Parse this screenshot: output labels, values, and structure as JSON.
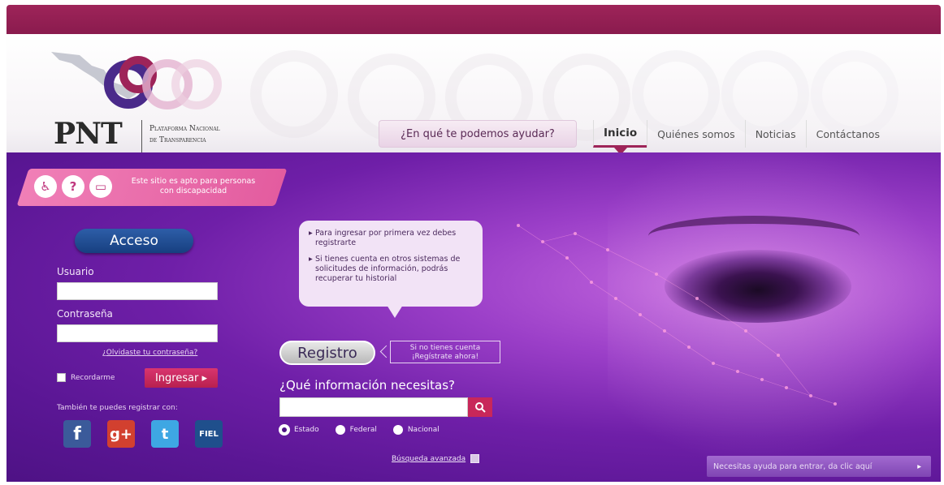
{
  "header": {
    "logo_abbrev": "PNT",
    "logo_line1": "Plataforma Nacional",
    "logo_line2": "de Transparencia",
    "help_prompt": "¿En qué te podemos ayudar?",
    "nav": [
      {
        "label": "Inicio",
        "active": true
      },
      {
        "label": "Quiénes somos",
        "active": false
      },
      {
        "label": "Noticias",
        "active": false
      },
      {
        "label": "Contáctanos",
        "active": false
      }
    ]
  },
  "accessibility": {
    "text": "Este sitio es apto para personas con discapacidad",
    "icons": [
      "wheelchair-icon",
      "hearing-icon",
      "speech-icon"
    ]
  },
  "login": {
    "title": "Acceso",
    "user_label": "Usuario",
    "user_value": "",
    "password_label": "Contraseña",
    "password_value": "",
    "forgot": "¿Olvidaste tu contraseña?",
    "remember": "Recordarme",
    "submit": "Ingresar ▸",
    "social_text": "También te puedes registrar con:",
    "social": [
      "f",
      "g+",
      "t",
      "FIEL"
    ]
  },
  "info_bubble": {
    "item1": "Para ingresar por primera vez debes registrarte",
    "item2": "Si tienes cuenta en otros sistemas de solicitudes de información, podrás recuperar tu historial"
  },
  "register": {
    "button": "Registro",
    "note": "Si no tienes cuenta ¡Regístrate ahora!"
  },
  "search": {
    "question": "¿Qué información necesitas?",
    "value": "",
    "options": [
      {
        "label": "Estado",
        "selected": true
      },
      {
        "label": "Federal",
        "selected": false
      },
      {
        "label": "Nacional",
        "selected": false
      }
    ],
    "advanced": "Búsqueda avanzada"
  },
  "help_bar": {
    "text": "Necesitas ayuda para entrar, da clic aquí",
    "arrow": "▸"
  },
  "colors": {
    "brand_magenta": "#9e2459",
    "purple": "#6f1fa8",
    "accent_pink": "#c8275a",
    "blue": "#2d5ea8"
  }
}
